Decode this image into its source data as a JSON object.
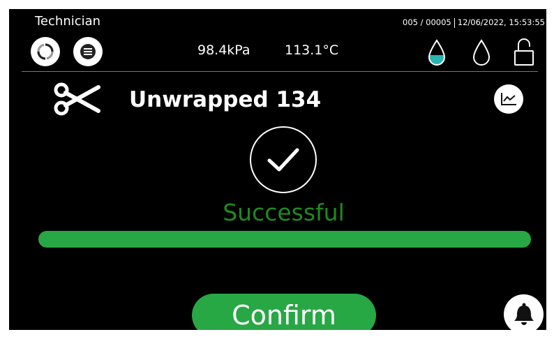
{
  "header": {
    "user": "Technician",
    "cycle_counter": "005 / 00005",
    "datetime": "12/06/2022, 15:53:55",
    "pressure": "98.4kPa",
    "temperature": "113.1°C"
  },
  "icons": {
    "refresh": "refresh-icon",
    "menu": "menu-icon",
    "water_tank_1": "water-drop-filled-icon",
    "water_tank_2": "water-drop-empty-icon",
    "door": "unlocked-padlock-icon",
    "program": "scissors-icon",
    "graph": "graph-icon",
    "result": "checkmark-icon",
    "alarm": "bell-icon"
  },
  "program": {
    "name": "Unwrapped 134"
  },
  "result": {
    "text": "Successful"
  },
  "progress": {
    "percent": 100
  },
  "actions": {
    "confirm_label": "Confirm"
  },
  "colors": {
    "background": "#000000",
    "success_text": "#1e8b1e",
    "progress_fill": "#28a745",
    "button_green": "#28a745",
    "water_fill": "#2bb6b0"
  }
}
